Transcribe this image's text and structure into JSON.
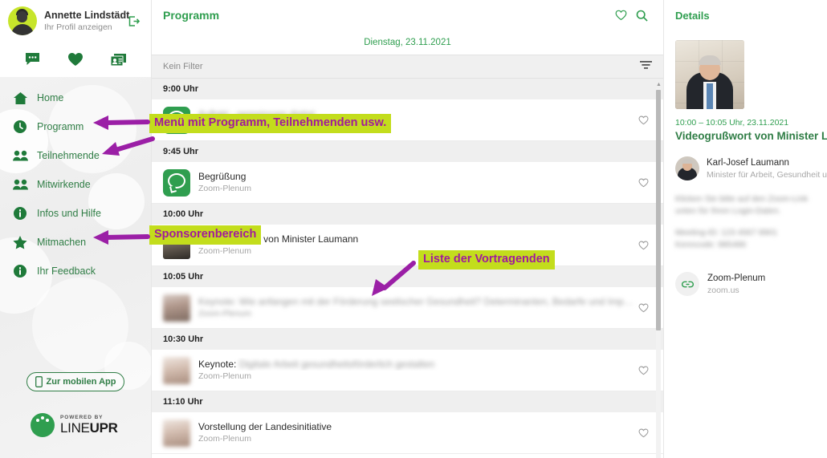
{
  "sidebar": {
    "profile": {
      "name": "Annette Lindstädt",
      "subtitle": "Ihr Profil anzeigen",
      "logout_icon": "logout-icon"
    },
    "quick_icons": [
      {
        "name": "chat-icon"
      },
      {
        "name": "heart-icon"
      },
      {
        "name": "contacts-icon"
      }
    ],
    "items": [
      {
        "label": "Home",
        "icon": "home-icon"
      },
      {
        "label": "Programm",
        "icon": "clock-icon"
      },
      {
        "label": "Teilnehmende",
        "icon": "people-icon"
      },
      {
        "label": "Mitwirkende",
        "icon": "people-icon"
      },
      {
        "label": "Infos und Hilfe",
        "icon": "info-icon"
      },
      {
        "label": "Mitmachen",
        "icon": "star-icon"
      },
      {
        "label": "Ihr Feedback",
        "icon": "info-icon"
      }
    ],
    "mobile_app_button": "Zur mobilen App",
    "brand": {
      "powered_by": "POWERED BY",
      "name_light": "LINE",
      "name_bold": "UPR"
    }
  },
  "main": {
    "title": "Programm",
    "header_icons": [
      {
        "name": "favorites-heart-icon"
      },
      {
        "name": "search-icon"
      }
    ],
    "date": "Dienstag, 23.11.2021",
    "filter": {
      "text": "Kein Filter",
      "icon": "filter-icon"
    },
    "groups": [
      {
        "time": "9:00 Uhr",
        "sessions": [
          {
            "title": "Auftakt - gemeinsam digital",
            "subtitle": "Zoom-Plenum",
            "thumb": "green-bubble",
            "redacted": true
          }
        ]
      },
      {
        "time": "9:45 Uhr",
        "sessions": [
          {
            "title": "Begrüßung",
            "subtitle": "Zoom-Plenum",
            "thumb": "green-bubble",
            "redacted": false
          }
        ]
      },
      {
        "time": "10:00 Uhr",
        "sessions": [
          {
            "title": "Videogrußwort von Minister Laumann",
            "subtitle": "Zoom-Plenum",
            "thumb": "laumann-photo",
            "redacted": false
          }
        ]
      },
      {
        "time": "10:05 Uhr",
        "sessions": [
          {
            "title": "Keynote: Wie anfangen mit der Förderung seelischer Gesundheit? Determinanten, Bedarfe und Implementierung .",
            "subtitle": "Zoom-Plenum",
            "thumb": "person-photo",
            "redacted": true
          }
        ]
      },
      {
        "time": "10:30 Uhr",
        "sessions": [
          {
            "title": "Keynote:",
            "title_redacted": "Digitale Arbeit gesundheitsförderlich gestalten",
            "subtitle": "Zoom-Plenum",
            "thumb": "person-photo-2",
            "redacted": false
          }
        ]
      },
      {
        "time": "11:10 Uhr",
        "sessions": [
          {
            "title": "Vorstellung der Landesinitiative",
            "subtitle": "Zoom-Plenum",
            "thumb": "person-photo-2",
            "redacted": false
          }
        ]
      }
    ]
  },
  "details": {
    "header": "Details",
    "time": "10:00 – 10:05 Uhr, 23.11.2021",
    "title": "Videogrußwort von Minister Lau",
    "speaker": {
      "name": "Karl-Josef Laumann",
      "role": "Minister für Arbeit, Gesundheit und S"
    },
    "body_paragraphs": [
      "Klicken Sie bitte auf den Zoom-Link unten für Ihren Login-Daten.",
      "Meeting-ID: 123 4567 8901  Kenncode: 985486"
    ],
    "link": {
      "name": "Zoom-Plenum",
      "url": "zoom.us",
      "icon": "link-icon"
    }
  },
  "annotations": [
    {
      "id": "menu",
      "text": "Menü mit Programm, Teilnehmenden usw."
    },
    {
      "id": "sponsoren",
      "text": "Sponsorenbereich"
    },
    {
      "id": "vortragende",
      "text": "Liste der Vortragenden"
    }
  ],
  "colors": {
    "green": "#2f9e4f",
    "green_dark": "#2f7d45",
    "annotation_bg": "#c3dd1c",
    "annotation_fg": "#a01a9c",
    "avatar_bg": "#c7e52b"
  }
}
